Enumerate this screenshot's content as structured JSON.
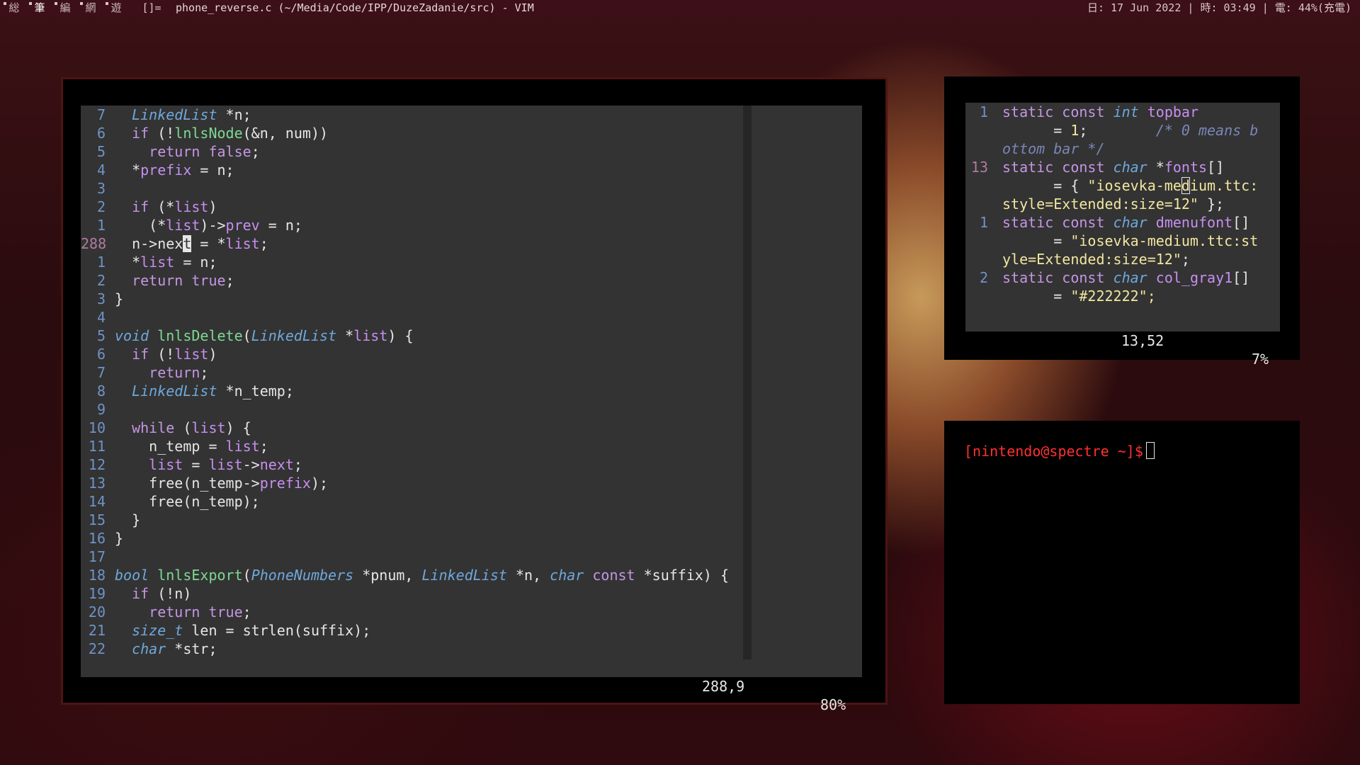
{
  "topbar": {
    "tags": [
      "総",
      "筆",
      "編",
      "網",
      "遊"
    ],
    "layout": "[]=",
    "window_title": "phone_reverse.c (~/Media/Code/IPP/DuzeZadanie/src) - VIM",
    "status": "日: 17 Jun 2022 | 時: 03:49 | 電: 44%(充電)"
  },
  "left_vim": {
    "lines": [
      {
        "n": "7",
        "c": "  LinkedList *n;"
      },
      {
        "n": "6",
        "c": "  if (!lnlsNode(&n, num))"
      },
      {
        "n": "5",
        "c": "    return false;"
      },
      {
        "n": "4",
        "c": "  *prefix = n;"
      },
      {
        "n": "3",
        "c": ""
      },
      {
        "n": "2",
        "c": "  if (*list)"
      },
      {
        "n": "1",
        "c": "    (*list)->prev = n;"
      },
      {
        "n": "288",
        "c": "  n->next = *list;"
      },
      {
        "n": "1",
        "c": "  *list = n;"
      },
      {
        "n": "2",
        "c": "  return true;"
      },
      {
        "n": "3",
        "c": "}"
      },
      {
        "n": "4",
        "c": ""
      },
      {
        "n": "5",
        "c": "void lnlsDelete(LinkedList *list) {"
      },
      {
        "n": "6",
        "c": "  if (!list)"
      },
      {
        "n": "7",
        "c": "    return;"
      },
      {
        "n": "8",
        "c": "  LinkedList *n_temp;"
      },
      {
        "n": "9",
        "c": ""
      },
      {
        "n": "10",
        "c": "  while (list) {"
      },
      {
        "n": "11",
        "c": "    n_temp = list;"
      },
      {
        "n": "12",
        "c": "    list = list->next;"
      },
      {
        "n": "13",
        "c": "    free(n_temp->prefix);"
      },
      {
        "n": "14",
        "c": "    free(n_temp);"
      },
      {
        "n": "15",
        "c": "  }"
      },
      {
        "n": "16",
        "c": "}"
      },
      {
        "n": "17",
        "c": ""
      },
      {
        "n": "18",
        "c": "bool lnlsExport(PhoneNumbers *pnum, LinkedList *n, char const *suffix) {"
      },
      {
        "n": "19",
        "c": "  if (!n)"
      },
      {
        "n": "20",
        "c": "    return true;"
      },
      {
        "n": "21",
        "c": "  size_t len = strlen(suffix);"
      },
      {
        "n": "22",
        "c": "  char *str;"
      }
    ],
    "ruler_pos": "288,9",
    "ruler_pct": "80%"
  },
  "right_vim": {
    "lines": [
      {
        "n": "1",
        "c": "static const int topbar"
      },
      {
        "n": "",
        "c": "      = 1;        /* 0 means b"
      },
      {
        "n": "",
        "c": "ottom bar */"
      },
      {
        "n": "13",
        "c": "static const char *fonts[]"
      },
      {
        "n": "",
        "c": "      = { \"iosevka-medium.ttc:"
      },
      {
        "n": "",
        "c": "style=Extended:size=12\" };"
      },
      {
        "n": "1",
        "c": "static const char dmenufont[]"
      },
      {
        "n": "",
        "c": "      = \"iosevka-medium.ttc:st"
      },
      {
        "n": "",
        "c": "yle=Extended:size=12\";"
      },
      {
        "n": "2",
        "c": "static const char col_gray1[]"
      },
      {
        "n": "",
        "c": "      = \"#222222\";"
      }
    ],
    "ruler_pos": "13,52",
    "ruler_pct": "7%"
  },
  "terminal": {
    "prompt": "[nintendo@spectre ~]$"
  }
}
